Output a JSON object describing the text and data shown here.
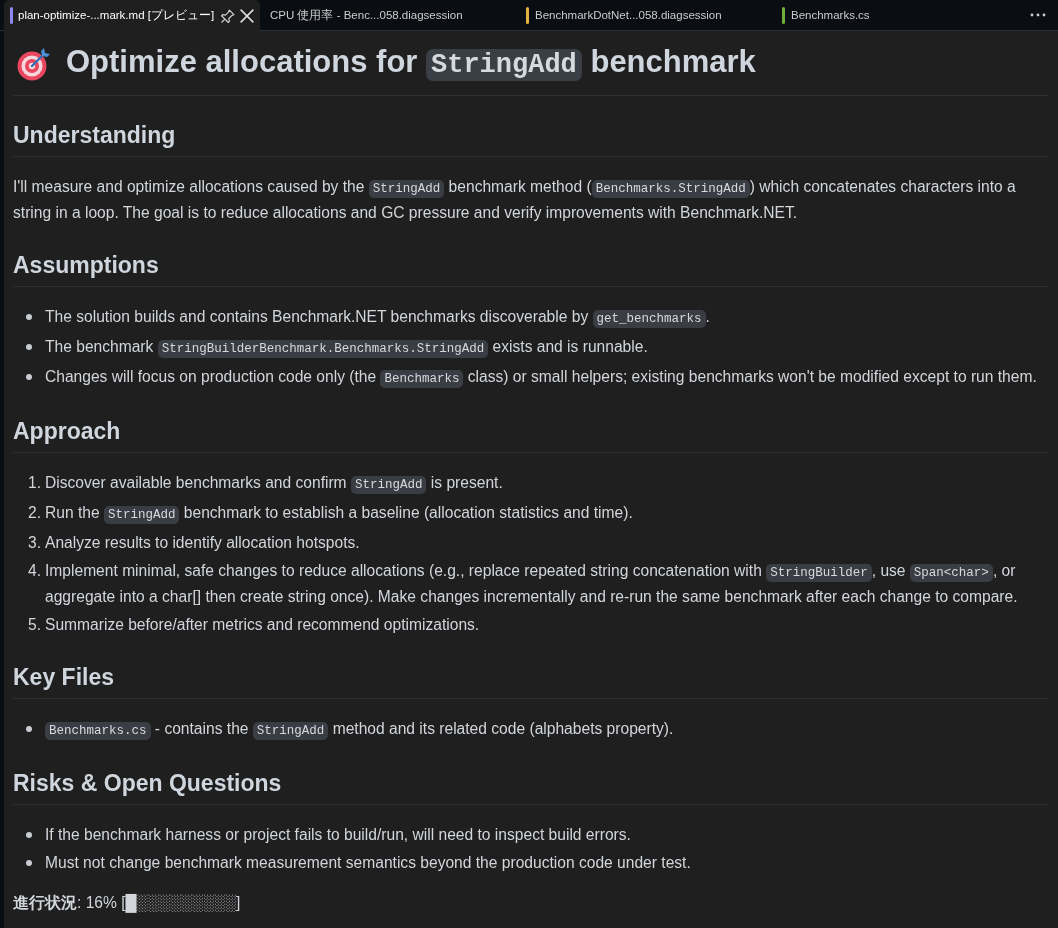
{
  "tabs": [
    {
      "label": "plan-optimize-...mark.md [プレビュー]",
      "selected": true,
      "color": "#8f86f0"
    },
    {
      "label": "CPU 使用率 - Benc...058.diagsession",
      "selected": false
    },
    {
      "label": "BenchmarkDotNet...058.diagsession",
      "selected": false,
      "color": "#e3b341"
    },
    {
      "label": "Benchmarks.cs",
      "selected": false,
      "color": "#6fae3a"
    }
  ],
  "document": {
    "title": [
      {
        "kind": "text",
        "text": "Optimize allocations for "
      },
      {
        "kind": "code",
        "text": "StringAdd"
      },
      {
        "kind": "text",
        "text": " benchmark"
      }
    ],
    "sections": [
      {
        "heading": "Understanding",
        "blocks": [
          {
            "kind": "paragraph",
            "parts": [
              {
                "kind": "text",
                "text": "I'll measure and optimize allocations caused by the "
              },
              {
                "kind": "code",
                "text": "StringAdd"
              },
              {
                "kind": "text",
                "text": " benchmark method ("
              },
              {
                "kind": "code",
                "text": "Benchmarks.StringAdd"
              },
              {
                "kind": "text",
                "text": ") which concatenates characters into a string in a loop. The goal is to reduce allocations and GC pressure and verify improvements with Benchmark.NET."
              }
            ]
          }
        ]
      },
      {
        "heading": "Assumptions",
        "blocks": [
          {
            "kind": "bullets",
            "items": [
              {
                "parts": [
                  {
                    "kind": "text",
                    "text": "The solution builds and contains Benchmark.NET benchmarks discoverable by "
                  },
                  {
                    "kind": "code",
                    "text": "get_benchmarks"
                  },
                  {
                    "kind": "text",
                    "text": "."
                  }
                ]
              },
              {
                "parts": [
                  {
                    "kind": "text",
                    "text": "The benchmark "
                  },
                  {
                    "kind": "code",
                    "text": "StringBuilderBenchmark.Benchmarks.StringAdd"
                  },
                  {
                    "kind": "text",
                    "text": " exists and is runnable."
                  }
                ]
              },
              {
                "parts": [
                  {
                    "kind": "text",
                    "text": "Changes will focus on production code only (the "
                  },
                  {
                    "kind": "code",
                    "text": "Benchmarks"
                  },
                  {
                    "kind": "text",
                    "text": " class) or small helpers; existing benchmarks won't be modified except to run them."
                  }
                ]
              }
            ]
          }
        ]
      },
      {
        "heading": "Approach",
        "blocks": [
          {
            "kind": "numbered",
            "items": [
              {
                "number": "1.",
                "parts": [
                  {
                    "kind": "text",
                    "text": "Discover available benchmarks and confirm "
                  },
                  {
                    "kind": "code",
                    "text": "StringAdd"
                  },
                  {
                    "kind": "text",
                    "text": " is present."
                  }
                ]
              },
              {
                "number": "2.",
                "parts": [
                  {
                    "kind": "text",
                    "text": "Run the "
                  },
                  {
                    "kind": "code",
                    "text": "StringAdd"
                  },
                  {
                    "kind": "text",
                    "text": " benchmark to establish a baseline (allocation statistics and time)."
                  }
                ]
              },
              {
                "number": "3.",
                "parts": [
                  {
                    "kind": "text",
                    "text": "Analyze results to identify allocation hotspots."
                  }
                ]
              },
              {
                "number": "4.",
                "parts": [
                  {
                    "kind": "text",
                    "text": "Implement minimal, safe changes to reduce allocations (e.g., replace repeated string concatenation with "
                  },
                  {
                    "kind": "code",
                    "text": "StringBuilder"
                  },
                  {
                    "kind": "text",
                    "text": ", use "
                  },
                  {
                    "kind": "code",
                    "text": "Span<char>"
                  },
                  {
                    "kind": "text",
                    "text": ", or aggregate into a char[] then create string once). Make changes incrementally and re-run the same benchmark after each change to compare."
                  }
                ]
              },
              {
                "number": "5.",
                "parts": [
                  {
                    "kind": "text",
                    "text": "Summarize before/after metrics and recommend optimizations."
                  }
                ]
              }
            ]
          }
        ]
      },
      {
        "heading": "Key Files",
        "blocks": [
          {
            "kind": "bullets",
            "items": [
              {
                "parts": [
                  {
                    "kind": "code",
                    "text": "Benchmarks.cs"
                  },
                  {
                    "kind": "text",
                    "text": " - contains the "
                  },
                  {
                    "kind": "code",
                    "text": "StringAdd"
                  },
                  {
                    "kind": "text",
                    "text": " method and its related code (alphabets property)."
                  }
                ]
              }
            ]
          }
        ]
      },
      {
        "heading": "Risks & Open Questions",
        "blocks": [
          {
            "kind": "bullets",
            "items": [
              {
                "parts": [
                  {
                    "kind": "text",
                    "text": "If the benchmark harness or project fails to build/run, will need to inspect build errors."
                  }
                ]
              },
              {
                "parts": [
                  {
                    "kind": "text",
                    "text": "Must not change benchmark measurement semantics beyond the production code under test."
                  }
                ]
              }
            ]
          }
        ]
      }
    ],
    "progress": "**進行状況**: 16% [█░░░░░░░░░]"
  }
}
